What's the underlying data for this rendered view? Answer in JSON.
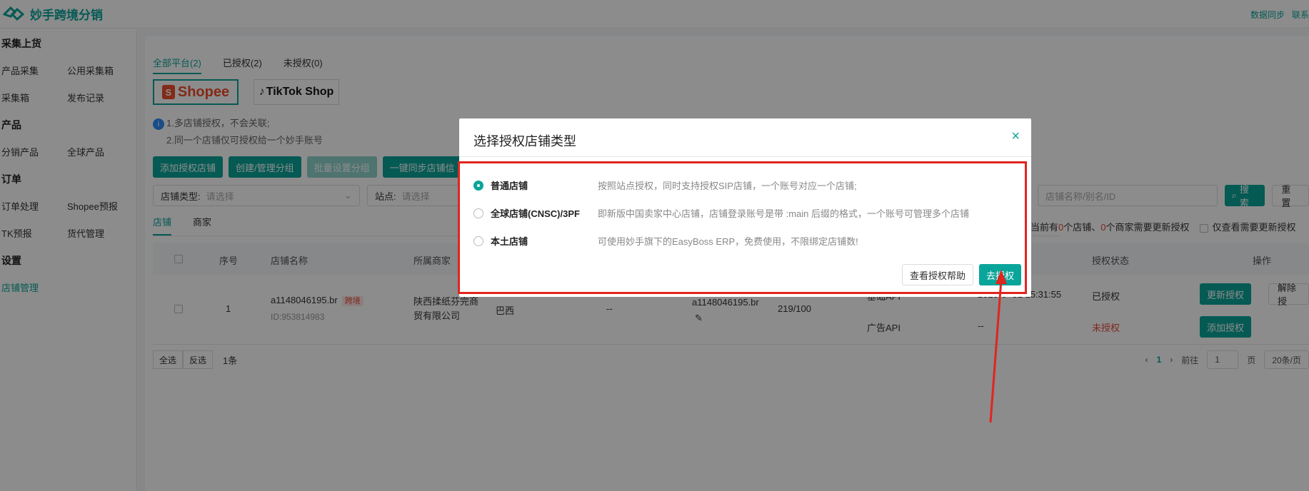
{
  "app": {
    "title": "妙手跨境分销"
  },
  "top_links": [
    "数据同步",
    "联系"
  ],
  "sidebar": {
    "groups": [
      {
        "title": "采集上货",
        "rows": [
          [
            "产品采集",
            "公用采集箱"
          ],
          [
            "采集箱",
            "发布记录"
          ]
        ]
      },
      {
        "title": "产品",
        "rows": [
          [
            "分销产品",
            "全球产品"
          ]
        ]
      },
      {
        "title": "订单",
        "rows": [
          [
            "订单处理",
            "Shopee预报"
          ],
          [
            "TK预报",
            "货代管理"
          ]
        ]
      },
      {
        "title": "设置",
        "rows": []
      }
    ],
    "active": "店铺管理"
  },
  "platform_tabs": [
    "全部平台(2)",
    "已授权(2)",
    "未授权(0)"
  ],
  "platforms": {
    "shopee": "Shopee",
    "tiktok": "TikTok Shop"
  },
  "tips": [
    "1.多店铺授权，不会关联;",
    "2.同一个店铺仅可授权给一个妙手账号"
  ],
  "actions": [
    "添加授权店铺",
    "创建/管理分组",
    "批量设置分组",
    "一键同步店铺信"
  ],
  "filters": {
    "store_type_label": "店铺类型:",
    "store_type_placeholder": "请选择",
    "site_label": "站点:",
    "site_placeholder": "请选择",
    "search_placeholder": "店铺名称/别名/ID",
    "search_btn": "搜索",
    "reset_btn": "重置"
  },
  "subtabs": [
    "店铺",
    "商家"
  ],
  "notice": {
    "p1": "当前有",
    "n1": "0",
    "p2": "个店铺、",
    "n2": "0",
    "p3": "个商家需要更新授权",
    "only": "仅查看需要更新授权"
  },
  "table": {
    "headers": [
      "序号",
      "店铺名称",
      "所属商家",
      "授权状态",
      "操作"
    ],
    "row": {
      "index": "1",
      "store_name": "a1148046195.br",
      "tag": "跨境",
      "store_id": "ID:953814983",
      "merchant": "陕西揉纸芬完商贸有限公司",
      "site": "巴西",
      "dash": "--",
      "account": "a1148046195.br",
      "quota": "219/100",
      "api_basic": "基础API",
      "expire": "2025-0 -31 15:31:55",
      "status_basic": "已授权",
      "api_ad": "广告API",
      "expire_ad": "--",
      "status_ad": "未授权",
      "btn_update": "更新授权",
      "btn_remove": "解除授",
      "btn_add": "添加授权"
    }
  },
  "footer": {
    "select_all": "全选",
    "invert": "反选",
    "count": "1条",
    "page": "1",
    "goto": "前往",
    "goto_val": "1",
    "page_unit": "页",
    "page_size": "20条/页"
  },
  "modal": {
    "title": "选择授权店铺类型",
    "options": [
      {
        "name": "普通店铺",
        "desc": "按照站点授权，同时支持授权SIP店铺，一个账号对应一个店铺;",
        "selected": true
      },
      {
        "name": "全球店铺(CNSC)/3PF",
        "desc": "即新版中国卖家中心店铺，店铺登录账号是带 :main 后缀的格式，一个账号可管理多个店铺",
        "selected": false
      },
      {
        "name": "本土店铺",
        "desc": "可使用妙手旗下的EasyBoss ERP，免费使用，不限绑定店铺数!",
        "selected": false
      }
    ],
    "help_btn": "查看授权帮助",
    "go_btn": "去授权"
  },
  "colors": {
    "accent": "#0aa59a",
    "highlight": "#e0251f"
  }
}
